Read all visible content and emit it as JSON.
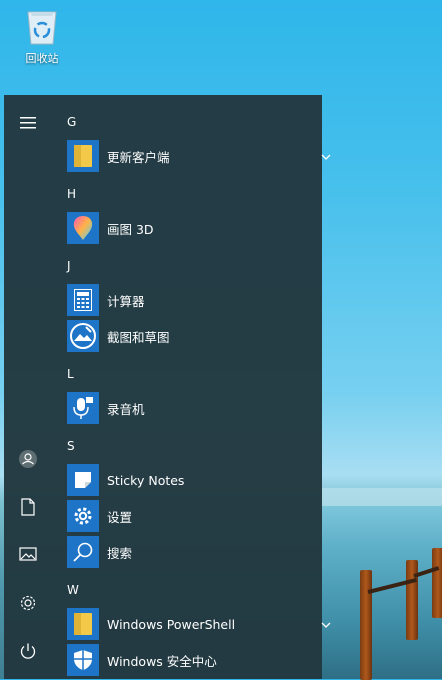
{
  "desktop": {
    "recycle_bin_label": "回收站"
  },
  "start_menu": {
    "sections": [
      {
        "letter": "G",
        "apps": [
          {
            "name": "更新客户端",
            "icon": "folder-icon",
            "expandable": true
          }
        ]
      },
      {
        "letter": "H",
        "apps": [
          {
            "name": "画图 3D",
            "icon": "paint3d-icon"
          }
        ]
      },
      {
        "letter": "J",
        "apps": [
          {
            "name": "计算器",
            "icon": "calculator-icon"
          },
          {
            "name": "截图和草图",
            "icon": "snip-sketch-icon"
          }
        ]
      },
      {
        "letter": "L",
        "apps": [
          {
            "name": "录音机",
            "icon": "voice-recorder-icon"
          }
        ]
      },
      {
        "letter": "S",
        "apps": [
          {
            "name": "Sticky Notes",
            "icon": "sticky-notes-icon"
          },
          {
            "name": "设置",
            "icon": "settings-gear-icon"
          },
          {
            "name": "搜索",
            "icon": "search-icon"
          }
        ]
      },
      {
        "letter": "W",
        "apps": [
          {
            "name": "Windows PowerShell",
            "icon": "folder-icon",
            "expandable": true
          },
          {
            "name": "Windows 安全中心",
            "icon": "shield-icon"
          }
        ]
      }
    ],
    "left_rail": [
      "hamburger-menu-icon",
      "user-account-icon",
      "documents-icon",
      "pictures-icon",
      "settings-icon",
      "power-icon"
    ],
    "colors": {
      "accent": "#1e74c6",
      "menu_bg": "#22383f",
      "folder": "#f3c94a"
    }
  }
}
